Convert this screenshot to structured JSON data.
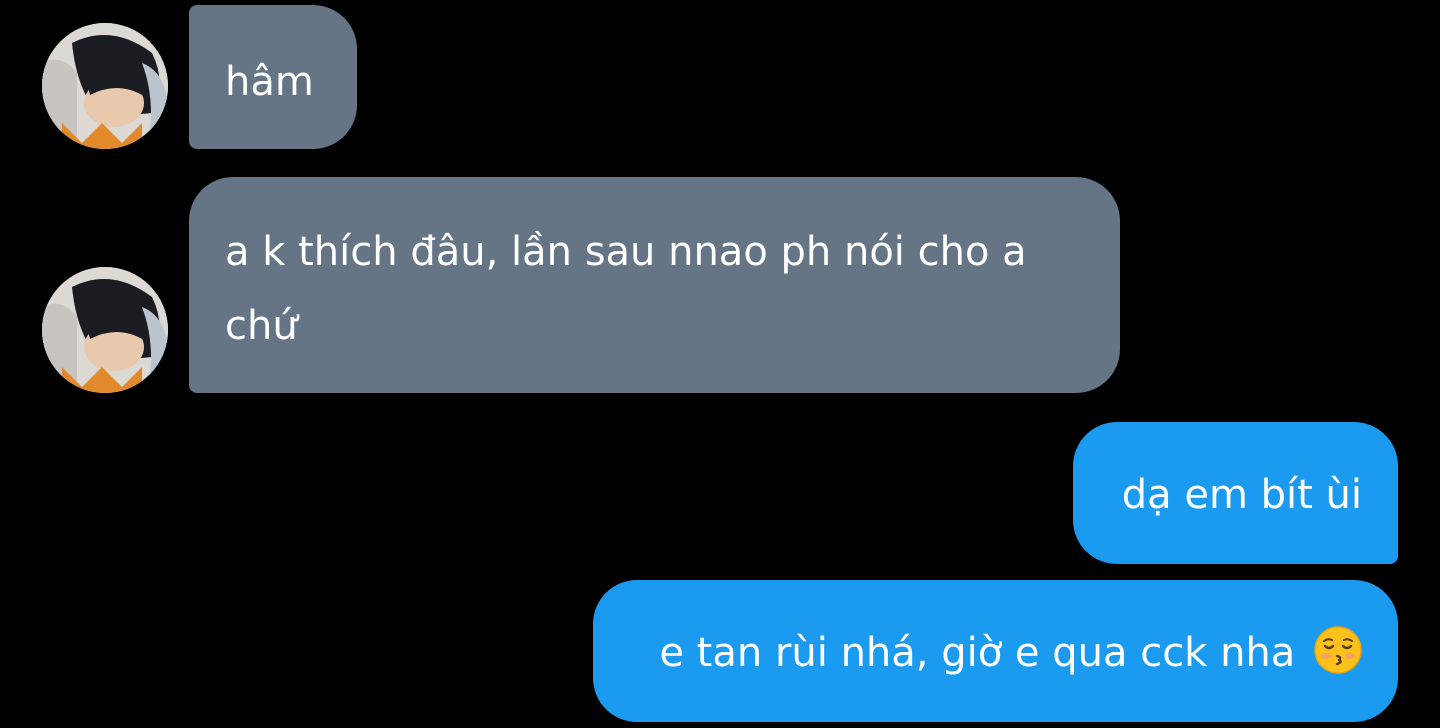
{
  "messages": [
    {
      "sender": "them",
      "text": "hâm"
    },
    {
      "sender": "them",
      "text": "a k thích đâu, lần sau nnao ph nói cho a chứ"
    },
    {
      "sender": "me",
      "text": "dạ em bít ùi"
    },
    {
      "sender": "me",
      "text": "e tan rùi nhá, giờ e qua cck nha"
    }
  ],
  "emoji": {
    "name": "kissing-face-with-closed-eyes-icon",
    "glyph": "😚"
  },
  "colors": {
    "background": "#000000",
    "incoming_bubble": "#657585",
    "outgoing_bubble": "#1b9bf0",
    "text": "#ffffff"
  }
}
